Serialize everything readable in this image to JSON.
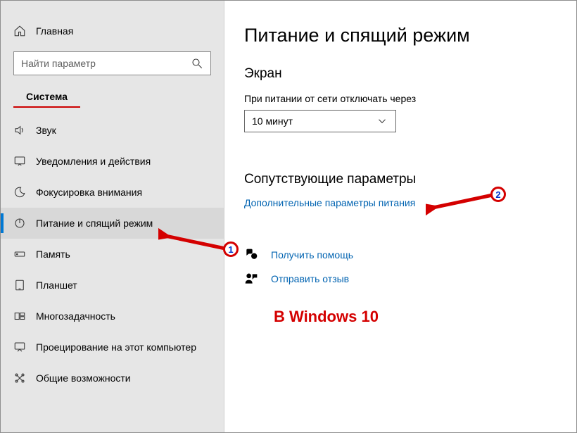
{
  "sidebar": {
    "home_label": "Главная",
    "search_placeholder": "Найти параметр",
    "section_label": "Система",
    "items": [
      {
        "label": "Звук"
      },
      {
        "label": "Уведомления и действия"
      },
      {
        "label": "Фокусировка внимания"
      },
      {
        "label": "Питание и спящий режим"
      },
      {
        "label": "Память"
      },
      {
        "label": "Планшет"
      },
      {
        "label": "Многозадачность"
      },
      {
        "label": "Проецирование на этот компьютер"
      },
      {
        "label": "Общие возможности"
      }
    ]
  },
  "main": {
    "page_title": "Питание и спящий режим",
    "screen_section_title": "Экран",
    "screen_field_label": "При питании от сети отключать через",
    "screen_select_value": "10 минут",
    "related": {
      "title": "Сопутствующие параметры",
      "link": "Дополнительные параметры питания"
    },
    "help": {
      "get_help": "Получить помощь",
      "feedback": "Отправить отзыв"
    }
  },
  "annotation": {
    "caption": "В Windows 10",
    "callout1": "1",
    "callout2": "2"
  }
}
